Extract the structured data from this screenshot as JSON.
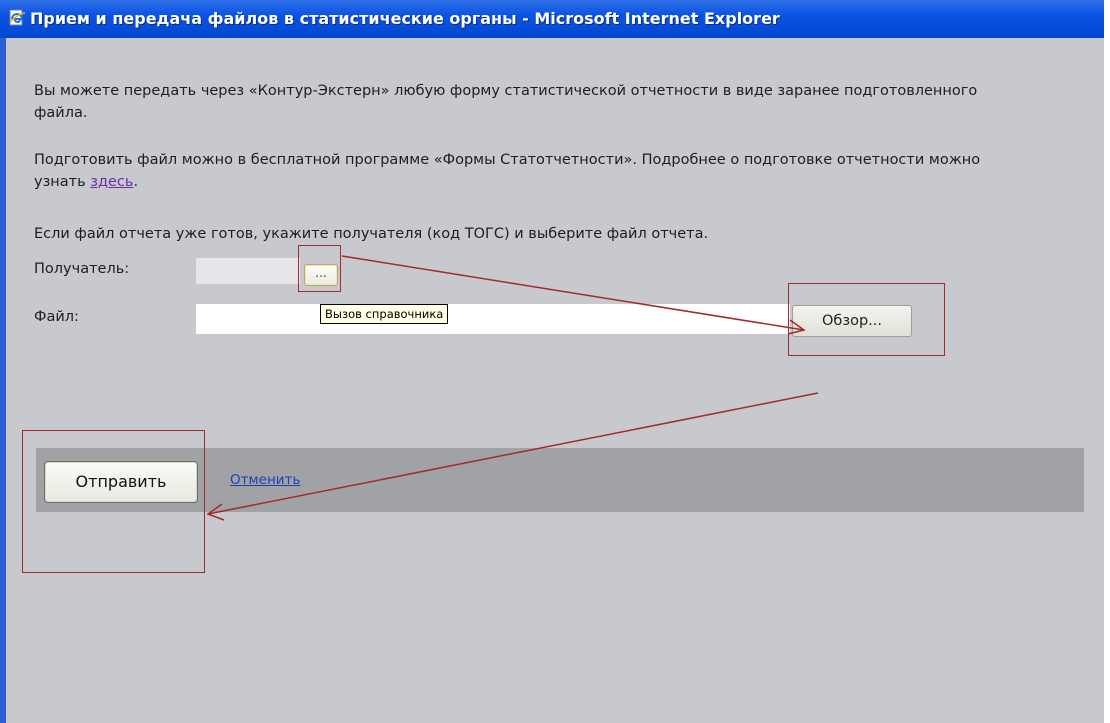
{
  "window": {
    "title": "Прием и передача файлов в статистические органы - Microsoft Internet Explorer",
    "title_icon": "ie-page-icon",
    "titlebar_color": "#0a54e3"
  },
  "content": {
    "paragraph1": "Вы можете передать через «Контур-Экстерн» любую форму статистической отчетности в виде заранее подготовленного файла.",
    "paragraph2_before_link": "Подготовить файл можно в бесплатной программе «Формы Статотчетности». Подробнее о подготовке отчетности можно узнать ",
    "paragraph2_link": "здесь",
    "paragraph2_after_link": ".",
    "paragraph3": "Если файл отчета уже готов, укажите получателя (код ТОГС) и выберите файл отчета."
  },
  "form": {
    "recipient_label": "Получатель:",
    "recipient_value": "",
    "lookup_button_label": "...",
    "lookup_tooltip": "Вызов справочника",
    "file_label": "Файл:",
    "file_value": "",
    "browse_button_label": "Обзор..."
  },
  "footer": {
    "submit_label": "Отправить",
    "cancel_label": "Отменить"
  },
  "colors": {
    "background": "#c8c9ce",
    "footer_bar": "#a1a2a6",
    "annotation": "#a42a2a",
    "link_visited": "#6b2fa8",
    "link": "#1f3fb5"
  }
}
